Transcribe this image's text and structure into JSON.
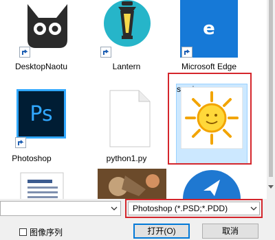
{
  "files": [
    {
      "label": "DesktopNaotu",
      "icon": "desktopnaotu-app-icon",
      "shortcut": true
    },
    {
      "label": "Lantern",
      "icon": "lantern-app-icon",
      "shortcut": true
    },
    {
      "label": "Microsoft Edge",
      "icon": "edge-app-icon",
      "shortcut": true
    },
    {
      "label": "Photoshop",
      "icon": "photoshop-app-icon",
      "shortcut": true
    },
    {
      "label": "python1.py",
      "icon": "document-file-icon",
      "shortcut": false
    },
    {
      "label": "sun.jpg",
      "icon": "sun-image-thumbnail",
      "shortcut": false,
      "selected": true
    },
    {
      "label": "",
      "icon": "text-document-icon"
    },
    {
      "label": "",
      "icon": "game-image-thumbnail"
    },
    {
      "label": "",
      "icon": "blue-app-icon"
    }
  ],
  "ps_text": "Ps",
  "edge_glyph": "e",
  "file_type": {
    "value": "Photoshop (*.PSD;*.PDD)"
  },
  "filename": {
    "value": ""
  },
  "image_sequence_label": "图像序列",
  "open_button": "打开(O)",
  "cancel_button": "取消",
  "colors": {
    "accent": "#0078d7",
    "highlight_red": "#d4252b",
    "photoshop_blue": "#31a8ff",
    "selection": "#cce8ff"
  }
}
